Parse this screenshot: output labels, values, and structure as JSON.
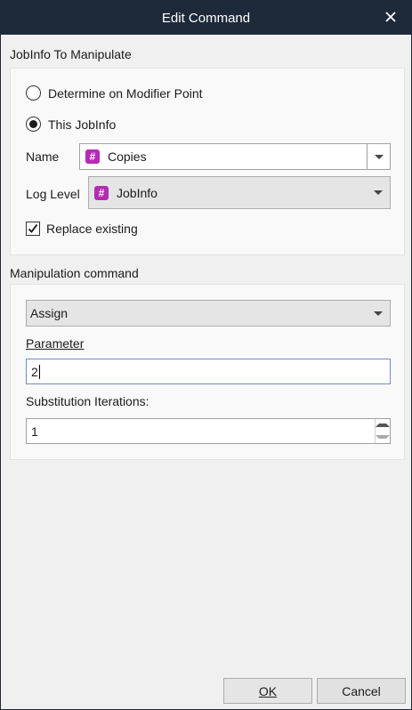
{
  "window": {
    "title": "Edit Command",
    "close_glyph": "✕"
  },
  "jobinfo_section": {
    "heading": "JobInfo To Manipulate",
    "radio_modifier_label": "Determine on Modifier Point",
    "radio_this_label": "This JobInfo",
    "selected_radio": "This JobInfo",
    "name_label": "Name",
    "name_value": "Copies",
    "loglevel_label": "Log Level",
    "loglevel_value": "JobInfo",
    "replace_label": "Replace existing",
    "replace_checked": true,
    "hash_glyph": "#"
  },
  "command_section": {
    "heading": "Manipulation command",
    "command_value": "Assign",
    "parameter_label": "Parameter",
    "parameter_value": "2",
    "substitution_label": "Substitution Iterations:",
    "substitution_value": "1"
  },
  "footer": {
    "ok_label": "OK",
    "cancel_label": "Cancel"
  },
  "colors": {
    "titlebar": "#1e2a3a",
    "icon_accent": "#b52bb5"
  }
}
